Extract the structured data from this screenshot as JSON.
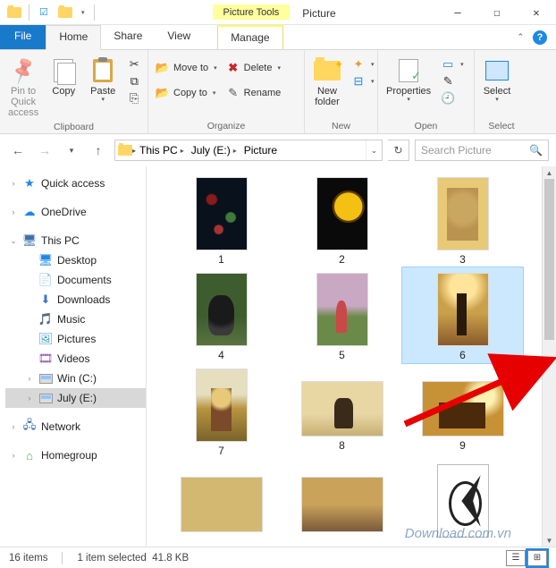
{
  "window": {
    "title": "Picture",
    "tool_tab": "Picture Tools"
  },
  "tabs": {
    "file": "File",
    "home": "Home",
    "share": "Share",
    "view": "View",
    "manage": "Manage"
  },
  "ribbon": {
    "clipboard": {
      "label": "Clipboard",
      "pin": "Pin to Quick\naccess",
      "copy": "Copy",
      "paste": "Paste",
      "cut": "Cut",
      "copy_path": "Copy path",
      "paste_shortcut": "Paste shortcut"
    },
    "organize": {
      "label": "Organize",
      "move_to": "Move to",
      "copy_to": "Copy to",
      "delete": "Delete",
      "rename": "Rename"
    },
    "new": {
      "label": "New",
      "new_folder": "New\nfolder",
      "new_item": "New item",
      "easy_access": "Easy access"
    },
    "open": {
      "label": "Open",
      "properties": "Properties",
      "open": "Open",
      "edit": "Edit",
      "history": "History"
    },
    "select": {
      "label": "Select",
      "select": "Select"
    }
  },
  "breadcrumb": {
    "segments": [
      "This PC",
      "July (E:)",
      "Picture"
    ]
  },
  "search": {
    "placeholder": "Search Picture"
  },
  "tree": {
    "quick_access": "Quick access",
    "onedrive": "OneDrive",
    "this_pc": "This PC",
    "desktop": "Desktop",
    "documents": "Documents",
    "downloads": "Downloads",
    "music": "Music",
    "pictures": "Pictures",
    "videos": "Videos",
    "win_c": "Win (C:)",
    "july_e": "July (E:)",
    "network": "Network",
    "homegroup": "Homegroup"
  },
  "items": [
    {
      "label": "1",
      "orient": "portrait",
      "cls": "p1"
    },
    {
      "label": "2",
      "orient": "portrait",
      "cls": "p2"
    },
    {
      "label": "3",
      "orient": "portrait",
      "cls": "p3"
    },
    {
      "label": "4",
      "orient": "portrait",
      "cls": "p4"
    },
    {
      "label": "5",
      "orient": "portrait",
      "cls": "p5"
    },
    {
      "label": "6",
      "orient": "portrait",
      "cls": "p6",
      "selected": true
    },
    {
      "label": "7",
      "orient": "portrait",
      "cls": "p7"
    },
    {
      "label": "8",
      "orient": "landscape",
      "cls": "p8"
    },
    {
      "label": "9",
      "orient": "landscape",
      "cls": "p9"
    },
    {
      "label": "",
      "orient": "landscape",
      "cls": "p10"
    },
    {
      "label": "",
      "orient": "landscape",
      "cls": "p11"
    },
    {
      "label": "",
      "orient": "portrait",
      "cls": "p12"
    }
  ],
  "status": {
    "count": "16 items",
    "selection": "1 item selected",
    "size": "41.8 KB"
  },
  "watermark": "Download.com.vn"
}
